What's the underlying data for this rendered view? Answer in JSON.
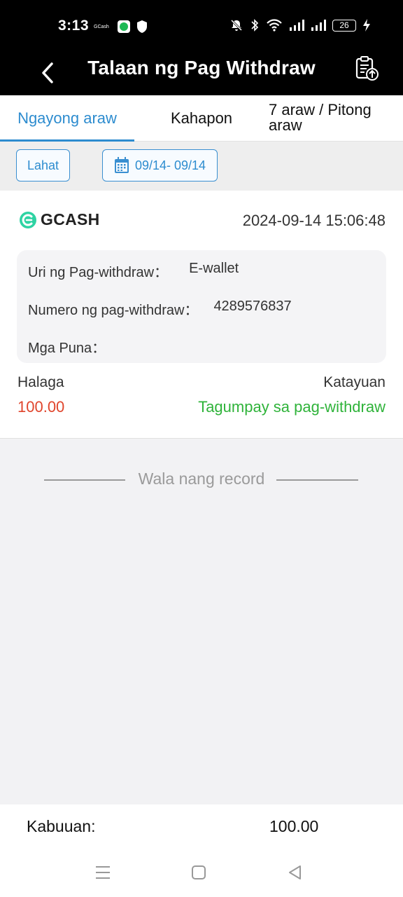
{
  "status_bar": {
    "time": "3:13",
    "notification_app": "GCash",
    "battery": "26",
    "icons": [
      "spotify-icon",
      "shield-icon",
      "mute-icon",
      "bluetooth-icon",
      "wifi-icon",
      "signal-icon",
      "signal-icon",
      "charging-icon"
    ]
  },
  "header": {
    "title": "Talaan ng Pag Withdraw",
    "back_icon": "back-arrow-icon",
    "export_icon": "clipboard-upload-icon"
  },
  "tabs": [
    {
      "label": "Ngayong araw",
      "active": true
    },
    {
      "label": "Kahapon",
      "active": false
    },
    {
      "label": "7 araw / Pitong araw",
      "active": false
    }
  ],
  "filters": {
    "all_label": "Lahat",
    "date_range": "09/14- 09/14",
    "date_icon": "calendar-icon"
  },
  "record": {
    "brand": "GCASH",
    "datetime": "2024-09-14 15:06:48",
    "type_label": "Uri ng Pag-withdraw：",
    "type_value": "E-wallet",
    "number_label": "Numero ng pag-withdraw：",
    "number_value": "4289576837",
    "remarks_label": "Mga Puna：",
    "remarks_value": "",
    "amount_label": "Halaga",
    "amount_value": "100.00",
    "status_label": "Katayuan",
    "status_value": "Tagumpay sa pag-withdraw"
  },
  "empty_text": "Wala nang record",
  "total": {
    "label": "Kabuuan:",
    "value": "100.00"
  },
  "colors": {
    "accent": "#2d8ccf",
    "amount": "#e0452c",
    "success": "#2fb33a",
    "gcash": "#2ed3a3"
  }
}
